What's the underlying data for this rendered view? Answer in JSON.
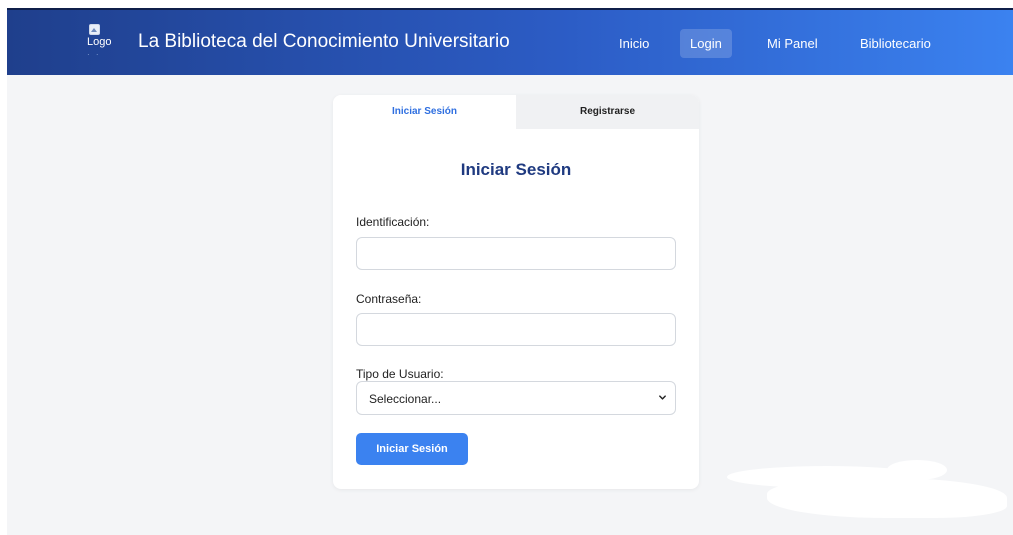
{
  "header": {
    "logo_alt": "Logo",
    "title": "La Biblioteca del Conocimiento Universitario",
    "nav": [
      {
        "label": "Inicio",
        "active": false
      },
      {
        "label": "Login",
        "active": true
      },
      {
        "label": "Mi Panel",
        "active": false
      },
      {
        "label": "Bibliotecario",
        "active": false
      }
    ]
  },
  "auth": {
    "tabs": [
      {
        "label": "Iniciar Sesión",
        "active": true
      },
      {
        "label": "Registrarse",
        "active": false
      }
    ],
    "form": {
      "title": "Iniciar Sesión",
      "id_label": "Identificación:",
      "id_value": "",
      "password_label": "Contraseña:",
      "password_value": "",
      "user_type_label": "Tipo de Usuario:",
      "user_type_selected": "Seleccionar...",
      "submit_label": "Iniciar Sesión"
    }
  },
  "colors": {
    "nav_start": "#1f3f8c",
    "nav_end": "#3b82f0",
    "accent": "#3b82f0",
    "title_blue": "#1f3a80",
    "active_tab_text": "#2f6fe0"
  }
}
